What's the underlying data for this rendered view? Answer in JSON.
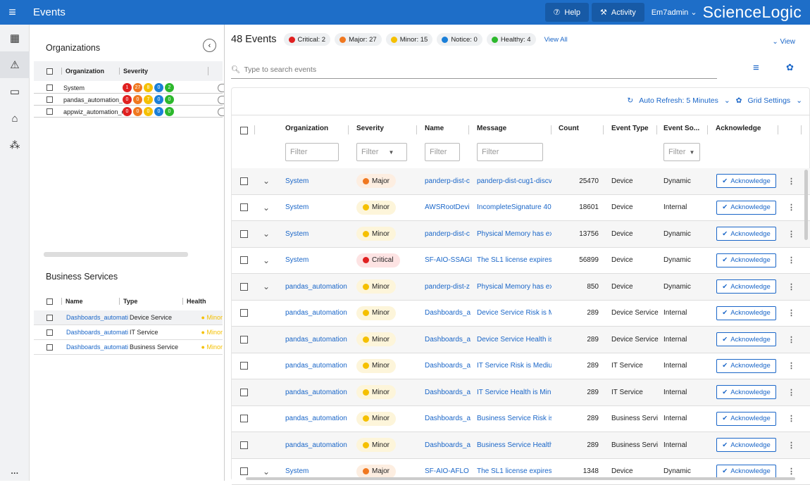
{
  "topbar": {
    "title": "Events",
    "help": "Help",
    "activity": "Activity",
    "user": "Em7admin",
    "logo": "ScienceLogic"
  },
  "organizations": {
    "title": "Organizations",
    "columns": [
      "Organization",
      "Severity"
    ],
    "rows": [
      {
        "name": "System",
        "counts": [
          "1",
          "27",
          "8",
          "0",
          "2"
        ]
      },
      {
        "name": "pandas_automation_c",
        "counts": [
          "0",
          "0",
          "7",
          "0",
          "0"
        ]
      },
      {
        "name": "appwiz_automation_c",
        "counts": [
          "0",
          "0",
          "0",
          "0",
          "0"
        ]
      }
    ]
  },
  "business_services": {
    "title": "Business Services",
    "columns": [
      "Name",
      "Type",
      "Health"
    ],
    "rows": [
      {
        "name": "Dashboards_automati",
        "type": "Device Service",
        "health": "Minor"
      },
      {
        "name": "Dashboards_automati",
        "type": "IT Service",
        "health": "Minor"
      },
      {
        "name": "Dashboards_automati",
        "type": "Business Service",
        "health": "Minor"
      }
    ]
  },
  "events": {
    "title": "48 Events",
    "chips": [
      {
        "label": "Critical: 2",
        "color": "#e02020"
      },
      {
        "label": "Major: 27",
        "color": "#f07820"
      },
      {
        "label": "Minor: 15",
        "color": "#f5c000"
      },
      {
        "label": "Notice: 0",
        "color": "#1a7fd8"
      },
      {
        "label": "Healthy: 4",
        "color": "#2db82d"
      }
    ],
    "view_all": "View All",
    "view": "View",
    "search_placeholder": "Type to search events",
    "auto_refresh": "Auto Refresh: 5 Minutes",
    "grid_settings": "Grid Settings",
    "columns": [
      "Organization",
      "Severity",
      "Name",
      "Message",
      "Count",
      "Event Type",
      "Event So...",
      "Acknowledge"
    ],
    "filter_placeholder": "Filter",
    "ack_label": "Acknowledge",
    "rows": [
      {
        "org": "System",
        "sev": "Major",
        "name": "panderp-dist-c",
        "msg": "panderp-dist-cug1-discv",
        "count": "25470",
        "type": "Device",
        "src": "Dynamic",
        "expand": "⌄"
      },
      {
        "org": "System",
        "sev": "Minor",
        "name": "AWSRootDevi",
        "msg": "IncompleteSignature 40",
        "count": "18601",
        "type": "Device",
        "src": "Internal",
        "expand": "⌄"
      },
      {
        "org": "System",
        "sev": "Minor",
        "name": "panderp-dist-c",
        "msg": "Physical Memory has ex",
        "count": "13756",
        "type": "Device",
        "src": "Dynamic",
        "expand": "⌄"
      },
      {
        "org": "System",
        "sev": "Critical",
        "name": "SF-AIO-SSAGI",
        "msg": "The SL1 license expires",
        "count": "56899",
        "type": "Device",
        "src": "Dynamic",
        "expand": "⌄"
      },
      {
        "org": "pandas_automation",
        "sev": "Minor",
        "name": "panderp-dist-z",
        "msg": "Physical Memory has ex",
        "count": "850",
        "type": "Device",
        "src": "Dynamic",
        "expand": "⌄"
      },
      {
        "org": "pandas_automation",
        "sev": "Minor",
        "name": "Dashboards_a",
        "msg": "Device Service Risk is M",
        "count": "289",
        "type": "Device Service",
        "src": "Internal",
        "expand": ""
      },
      {
        "org": "pandas_automation",
        "sev": "Minor",
        "name": "Dashboards_a",
        "msg": "Device Service Health is",
        "count": "289",
        "type": "Device Service",
        "src": "Internal",
        "expand": ""
      },
      {
        "org": "pandas_automation",
        "sev": "Minor",
        "name": "Dashboards_a",
        "msg": "IT Service Risk is Mediu",
        "count": "289",
        "type": "IT Service",
        "src": "Internal",
        "expand": ""
      },
      {
        "org": "pandas_automation",
        "sev": "Minor",
        "name": "Dashboards_a",
        "msg": "IT Service Health is Min",
        "count": "289",
        "type": "IT Service",
        "src": "Internal",
        "expand": ""
      },
      {
        "org": "pandas_automation",
        "sev": "Minor",
        "name": "Dashboards_a",
        "msg": "Business Service Risk is",
        "count": "289",
        "type": "Business Servi",
        "src": "Internal",
        "expand": ""
      },
      {
        "org": "pandas_automation",
        "sev": "Minor",
        "name": "Dashboards_a",
        "msg": "Business Service Health",
        "count": "289",
        "type": "Business Servi",
        "src": "Internal",
        "expand": ""
      },
      {
        "org": "System",
        "sev": "Major",
        "name": "SF-AIO-AFLO",
        "msg": "The SL1 license expires",
        "count": "1348",
        "type": "Device",
        "src": "Dynamic",
        "expand": "⌄"
      }
    ]
  },
  "colors": {
    "critical": "#e02020",
    "major": "#f07820",
    "minor": "#f5c000",
    "notice": "#1a7fd8",
    "healthy": "#2db82d"
  }
}
